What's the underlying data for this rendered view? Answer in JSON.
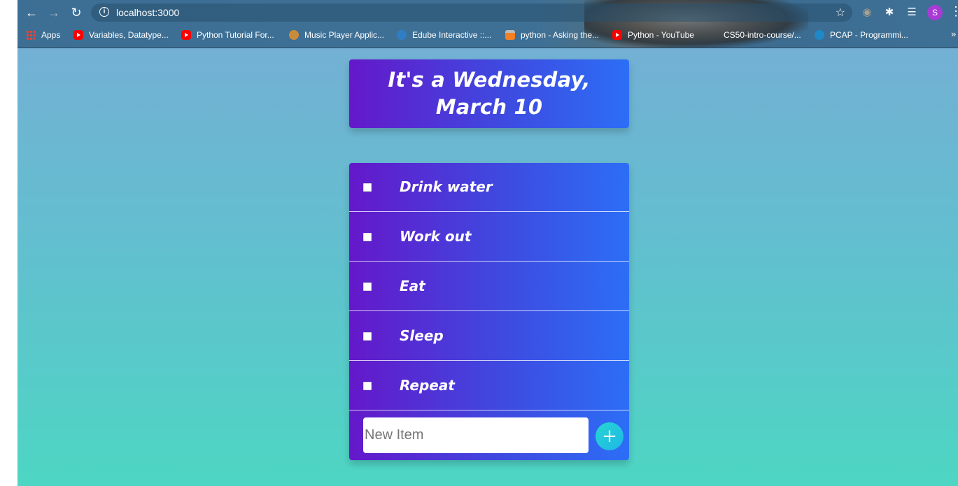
{
  "browser": {
    "url": "localhost:3000",
    "avatar_letter": "S",
    "bookmarks": [
      {
        "label": "Apps",
        "icon": "apps-grid-icon"
      },
      {
        "label": "Variables, Datatype...",
        "icon": "youtube-icon"
      },
      {
        "label": "Python Tutorial For...",
        "icon": "youtube-icon"
      },
      {
        "label": "Music Player Applic...",
        "icon": "music-app-icon"
      },
      {
        "label": "Edube Interactive ::...",
        "icon": "edube-icon"
      },
      {
        "label": "python - Asking the...",
        "icon": "stackoverflow-icon"
      },
      {
        "label": "Python - YouTube",
        "icon": "youtube-icon"
      },
      {
        "label": "CS50-intro-course/...",
        "icon": "none"
      },
      {
        "label": "PCAP - Programmi...",
        "icon": "pcap-icon"
      }
    ],
    "more_bookmarks": "»"
  },
  "app": {
    "heading": "It's a Wednesday, March 10",
    "items": [
      {
        "label": "Drink water",
        "checked": false
      },
      {
        "label": "Work out",
        "checked": false
      },
      {
        "label": "Eat",
        "checked": false
      },
      {
        "label": "Sleep",
        "checked": false
      },
      {
        "label": "Repeat",
        "checked": false
      }
    ],
    "new_item_placeholder": "New Item",
    "add_button_label": "+"
  },
  "colors": {
    "card_gradient_start": "#6418ca",
    "card_gradient_end": "#2c6ef6",
    "page_gradient_top": "#73b0d4",
    "page_gradient_bottom": "#4dd6c3",
    "add_button": "#1fb6e8"
  }
}
